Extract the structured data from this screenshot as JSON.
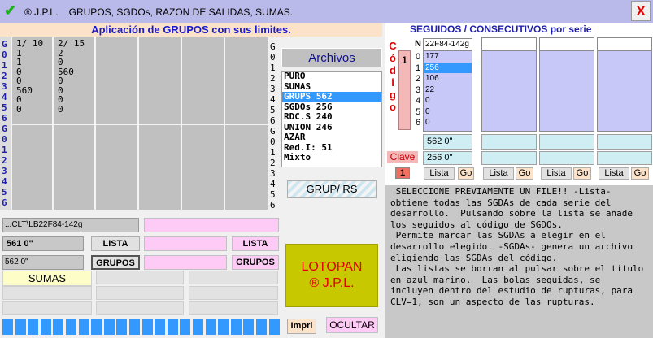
{
  "window": {
    "title": "® J.P.L.    GRUPOS, SGDOs, RAZON DE SALIDAS, SUMAS.",
    "close_label": "X"
  },
  "header": {
    "title": "Aplicación de GRUPOS con sus limites."
  },
  "left_strip": [
    "G",
    "0",
    "1",
    "2",
    "3",
    "4",
    "5",
    "6",
    "G",
    "0",
    "1",
    "2",
    "3",
    "4",
    "5",
    "6"
  ],
  "right_strip": [
    "G",
    "0",
    "1",
    "2",
    "3",
    "4",
    "5",
    "6",
    "G",
    "0",
    "1",
    "2",
    "3",
    "4",
    "5",
    "6"
  ],
  "grid": {
    "row1": [
      {
        "text": "1/ 10\n1\n1\n0\n0\n560\n0\n0"
      },
      {
        "text": "2/ 15\n2\n0\n560\n0\n0\n0\n0"
      },
      {
        "text": ""
      },
      {
        "text": ""
      },
      {
        "text": ""
      },
      {
        "text": ""
      }
    ],
    "row2": [
      {
        "text": ""
      },
      {
        "text": ""
      },
      {
        "text": ""
      },
      {
        "text": ""
      },
      {
        "text": ""
      },
      {
        "text": ""
      }
    ]
  },
  "archivos": {
    "title": "Archivos",
    "items": [
      "PURO",
      "SUMAS",
      "GRUPS 562",
      "SGDOs  256",
      "RDC.S 240",
      "UNION  246",
      "AZAR",
      "Red.I: 51",
      "Mixto"
    ],
    "selected_index": 2
  },
  "grup_rs_button": "GRUP/ RS",
  "file_path": "...CLT\\LB22F84-142g",
  "value_561": "561 0\"",
  "lista_button": "LISTA",
  "lista_pink_button": "LISTA",
  "value_562": "562 0\"",
  "grupos_button": "GRUPOS",
  "grupos_pink_button": "GRUPOS",
  "sumas_label": "SUMAS",
  "lotopan": {
    "line1": "LOTOPAN",
    "line2": "®  J.P.L."
  },
  "impri_button": "Impri",
  "ocultar_button": "OCULTAR",
  "seguidos": {
    "title": "SEGUIDOS   /   CONSECUTIVOS por serie",
    "codigo_letters": [
      "C",
      "ó",
      "d",
      "i",
      "g",
      "o"
    ],
    "codigo_num": "1",
    "n_label": "N",
    "n_rows": [
      "0",
      "1",
      "2",
      "3",
      "4",
      "5",
      "6"
    ],
    "file": "22F84-142g",
    "values": [
      "177",
      "256",
      "106",
      "22",
      "0",
      "0",
      "0"
    ],
    "selected_index": 1,
    "box1": "562  0\"",
    "box2": "256 0\"",
    "clave_label": "Clave",
    "clave_value": "1",
    "lista_label": "Lista",
    "go_label": "Go"
  },
  "info_text": " SELECCIONE PREVIAMENTE UN FILE!! -Lista-\nobtiene todas las SGDAs de cada serie del\ndesarrollo.  Pulsando sobre la lista se añade\nlos seguidos al código de SGDOs.\n Permite marcar las SGDAs a elegir en el\ndesarrollo elegido. -SGDAs- genera un archivo\neligiendo las SGDAs del código.\n Las listas se borran al pulsar sobre el título\nen azul marino.  Las bolas seguidas, se\nincluyen dentro del estudio de rupturas, para\nCLV=1, son un aspecto de las rupturas.",
  "colors": {
    "accent_blue": "#3399ff",
    "pink": "#fdcbf5",
    "header_peach": "#fde2ca"
  },
  "progress_segments": 22
}
